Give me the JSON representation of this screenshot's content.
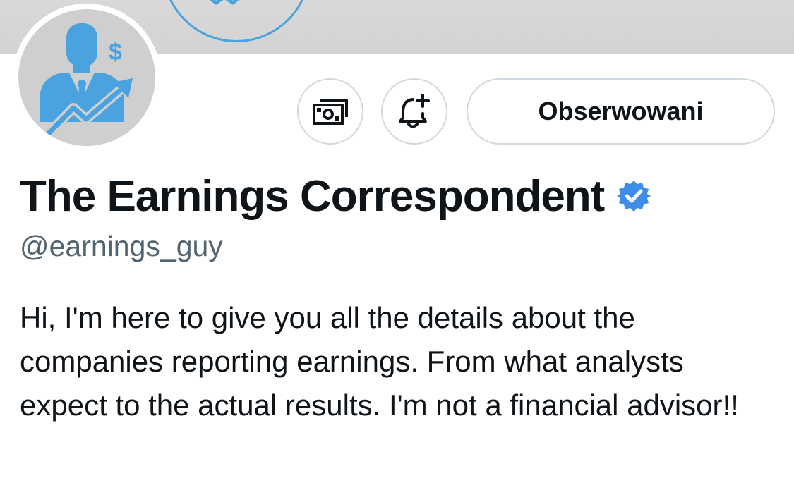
{
  "profile": {
    "display_name": "The Earnings Correspondent",
    "handle": "@earnings_guy",
    "bio": "Hi, I'm here to give you all the details about the companies reporting earnings. From what analysts expect to the actual results. I'm not a financial advisor!!",
    "verified": true
  },
  "actions": {
    "tip_icon": "money-icon",
    "notify_icon": "bell-plus-icon",
    "follow_label": "Obserwowani"
  },
  "colors": {
    "accent": "#4aa3df",
    "verified_badge": "#3f8de6",
    "text_primary": "#0f1419",
    "text_secondary": "#536471",
    "button_border": "#cfd9de",
    "banner": "#d6d6d6",
    "avatar_bg": "#cfcfcf"
  }
}
